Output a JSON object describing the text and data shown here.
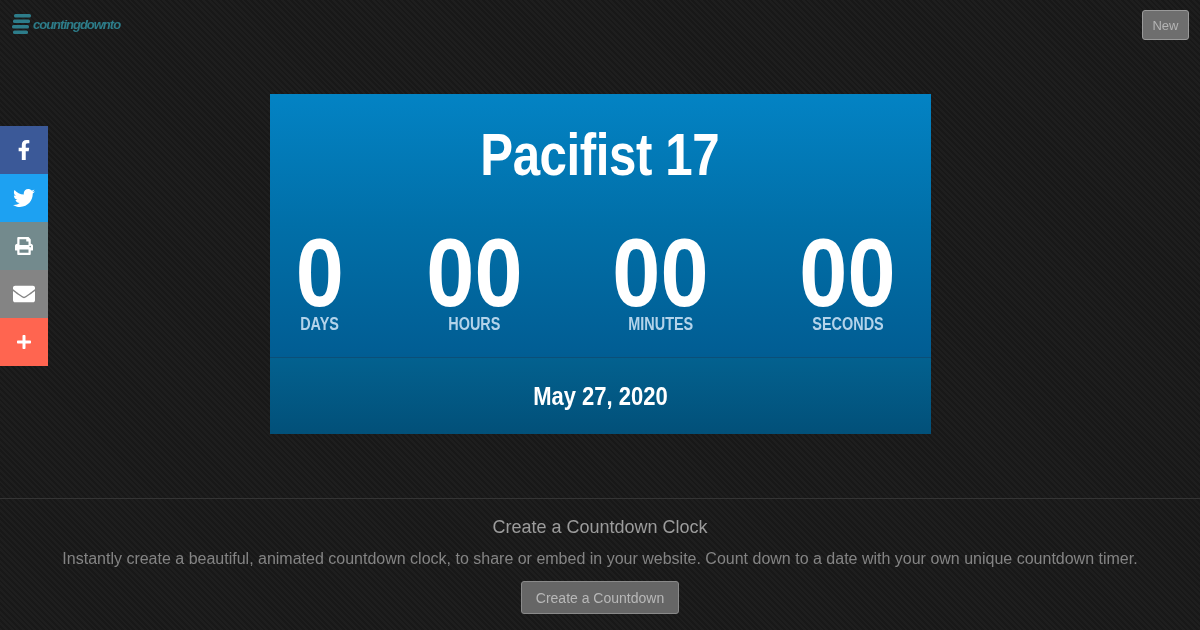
{
  "header": {
    "logo": "countingdownto",
    "new_button": "New"
  },
  "share_bar": [
    {
      "kind": "facebook",
      "color": "#3b5998"
    },
    {
      "kind": "twitter",
      "color": "#1da1f2"
    },
    {
      "kind": "print",
      "color": "#738a8d"
    },
    {
      "kind": "email",
      "color": "#848484"
    },
    {
      "kind": "more",
      "color": "#ff6550"
    }
  ],
  "countdown": {
    "title": "Pacifist 17",
    "units": [
      {
        "value": "0",
        "label": "DAYS"
      },
      {
        "value": "00",
        "label": "HOURS"
      },
      {
        "value": "00",
        "label": "MINUTES"
      },
      {
        "value": "00",
        "label": "SECONDS"
      }
    ],
    "date": "May 27, 2020"
  },
  "promo": {
    "heading": "Create a Countdown Clock",
    "text": "Instantly create a beautiful, animated countdown clock, to share or embed in your website. Count down to a date with your own unique countdown timer.",
    "button": "Create a Countdown"
  }
}
